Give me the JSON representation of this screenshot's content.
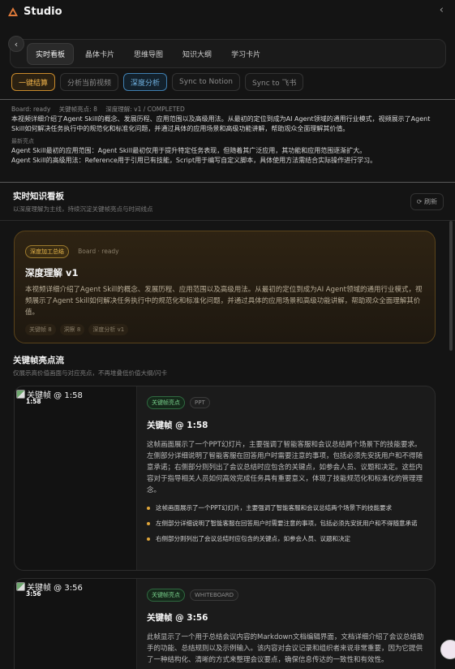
{
  "app": {
    "title": "Studio",
    "collapse_glyph": "‹",
    "back_glyph": "‹"
  },
  "tabs": [
    {
      "label": "实时看板",
      "active": true
    },
    {
      "label": "晶体卡片"
    },
    {
      "label": "思维导图"
    },
    {
      "label": "知识大纲"
    },
    {
      "label": "学习卡片"
    }
  ],
  "actions": {
    "one_click": "一键结算",
    "analyze_video": "分析当前视频",
    "deep_analysis": "深度分析",
    "sync_notion": "Sync to Notion",
    "sync_feishu": "Sync to 飞书"
  },
  "status": {
    "board": "Board: ready",
    "frames": "关键帧亮点: 8",
    "understanding": "深度理解: v1 / COMPLETED",
    "summary": "本视频详细介绍了Agent Skill的概念、发展历程、应用范围以及高级用法。从最初的定位到成为AI Agent领域的通用行业模式，视频展示了Agent Skill如何解决任务执行中的规范化和标准化问题，并通过具体的应用场景和高级功能讲解，帮助观众全面理解其价值。",
    "highlights_label": "最新亮点",
    "highlights": [
      "Agent Skill最初的应用范围：Agent Skill最初仅用于提升特定任务表现，但随着其广泛应用，其功能和应用范围逐渐扩大。",
      "Agent Skill的高级用法：Reference用于引用已有技能，Script用于编写自定义脚本，具体使用方法需结合实际操作进行学习。"
    ]
  },
  "kb": {
    "title": "实时知识看板",
    "subtitle": "以深度理解为主线，持续沉淀关键帧亮点与时间线点",
    "refresh": "刷新"
  },
  "deep_card": {
    "badge": "深度加工总结",
    "meta": "Board · ready",
    "title": "深度理解 v1",
    "body": "本视频详细介绍了Agent Skill的概念、发展历程、应用范围以及高级用法。从最初的定位到成为AI Agent领域的通用行业模式，视频展示了Agent Skill如何解决任务执行中的规范化和标准化问题，并通过具体的应用场景和高级功能讲解，帮助观众全面理解其价值。",
    "tags": [
      "关键帧 8",
      "洞察 8",
      "深度分析 v1"
    ]
  },
  "keyframes_section": {
    "title": "关键帧亮点流",
    "subtitle": "仅展示高价值画面与对应亮点，不再堆叠低价值大纲/闪卡"
  },
  "frames": [
    {
      "thumb_alt": "关键帧 @ 1:58",
      "time": "1:58",
      "badge": "关键帧亮点",
      "type": "PPT",
      "title": "关键帧 @ 1:58",
      "desc": "这帧画面展示了一个PPT幻灯片，主要强调了智能客服和会议总结两个场景下的技能要求。左侧部分详细说明了智能客服在回答用户时需要注意的事项，包括必须先安抚用户和不得随意承诺；右侧部分则列出了会议总结时应包含的关键点，如参会人员、议题和决定。这些内容对于指导相关人员如何高效完成任务具有重要意义，体现了技能规范化和标准化的管理理念。",
      "bullets": [
        "这帧画面展示了一个PPT幻灯片，主要强调了智能客服和会议总结两个场景下的技能要求",
        "左侧部分详细说明了智能客服在回答用户时需要注意的事项，包括必须先安抚用户和不得随意承诺",
        "右侧部分则列出了会议总结时应包含的关键点，如参会人员、议题和决定"
      ]
    },
    {
      "thumb_alt": "关键帧 @ 3:56",
      "time": "3:56",
      "badge": "关键帧亮点",
      "type": "WHITEBOARD",
      "title": "关键帧 @ 3:56",
      "desc": "此帧显示了一个用于总结会议内容的Markdown文档编辑界面，文档详细介绍了会议总结助手的功能、总结规则以及示例输入。该内容对会议记录和组织者来说非常重要，因为它提供了一种结构化、清晰的方式来整理会议要点，确保信息传达的一致性和有效性。",
      "bullets": []
    }
  ]
}
